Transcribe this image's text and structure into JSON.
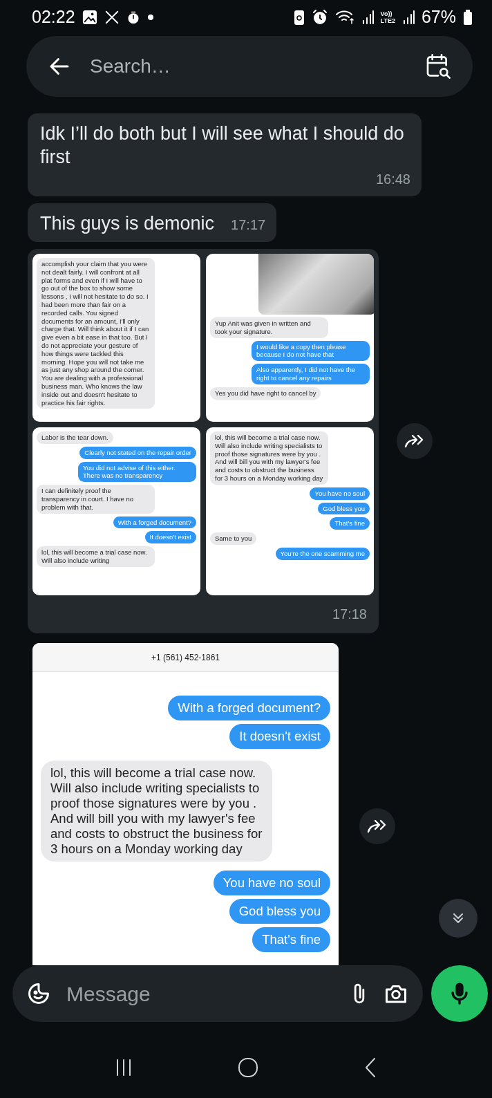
{
  "status_bar": {
    "time": "02:22",
    "network_top": "Vo))",
    "network_bottom": "LTE2",
    "battery": "67%"
  },
  "header": {
    "search_placeholder": "Search…"
  },
  "messages": [
    {
      "kind": "text",
      "text": "Idk I’ll do both but I will see what I should do first",
      "time": "16:48"
    },
    {
      "kind": "text",
      "text": "This guys is demonic",
      "time": "17:17"
    },
    {
      "kind": "image_grid",
      "time": "17:18",
      "images": [
        {
          "photo": false,
          "bubbles": [
            {
              "outgoing": false,
              "text": "accomplish your claim that you were not dealt fairly. I will confront at all plat forms and even if I will have to go out of the box to show some lessons , I will not hesitate to do so. I had been more than fair on a recorded calls. You signed documents for an amount, I'll only charge that. Will think about it if I can give even a bit ease in that too. But I do not appreciate your gesture of how things were tackled this morning. Hope you will not take me as just any shop around the corner. You are dealing with a professional business man. Who knows the law inside out and doesn't hesitate to practice his fair rights."
            }
          ]
        },
        {
          "photo": true,
          "bubbles": [
            {
              "outgoing": false,
              "text": "Yup Anit was given in written and took your signature."
            },
            {
              "outgoing": true,
              "text": "I would like a copy then please because I do not have that"
            },
            {
              "outgoing": true,
              "text": "Also apparently, I did not have the right to cancel any repairs"
            },
            {
              "outgoing": false,
              "text": "Yes you did have right to cancel by"
            }
          ]
        },
        {
          "photo": false,
          "bubbles": [
            {
              "outgoing": false,
              "text": "Labor is the tear down."
            },
            {
              "outgoing": true,
              "text": "Clearly not stated on the repair order"
            },
            {
              "outgoing": true,
              "text": "You did not advise of this either. There was no transparency"
            },
            {
              "outgoing": false,
              "text": "I can definitely proof the transparency in court. I have no problem with that."
            },
            {
              "outgoing": true,
              "text": "With a forged document?"
            },
            {
              "outgoing": true,
              "text": "It doesn't exist"
            },
            {
              "outgoing": false,
              "text": "lol, this will become a trial case now. Will also include writing"
            }
          ]
        },
        {
          "photo": false,
          "bubbles": [
            {
              "outgoing": false,
              "text": "lol, this will become a trial case now. Will also include writing specialists to proof those signatures were by you . And will bill you with my lawyer's fee and costs to obstruct the business for 3 hours on a Monday working day"
            },
            {
              "outgoing": true,
              "text": "You have no soul"
            },
            {
              "outgoing": true,
              "text": "God bless you"
            },
            {
              "outgoing": true,
              "text": "That's fine"
            },
            {
              "outgoing": false,
              "text": "Same to you"
            },
            {
              "outgoing": true,
              "text": "You're the one scamming me"
            }
          ]
        }
      ]
    },
    {
      "kind": "image",
      "contact": "+1 (561) 452-1861",
      "bubbles": [
        {
          "outgoing": true,
          "text": "With a forged document?"
        },
        {
          "outgoing": true,
          "text": "It doesn't exist"
        },
        {
          "outgoing": false,
          "text": "lol, this will become a trial case now. Will also include writing specialists to proof those signatures were by you . And will bill you with my lawyer's fee and costs to obstruct the business for 3 hours on a Monday working day"
        },
        {
          "outgoing": true,
          "text": "You have no soul"
        },
        {
          "outgoing": true,
          "text": "God bless you"
        },
        {
          "outgoing": true,
          "text": "That's fine"
        }
      ]
    }
  ],
  "composer": {
    "placeholder": "Message"
  }
}
